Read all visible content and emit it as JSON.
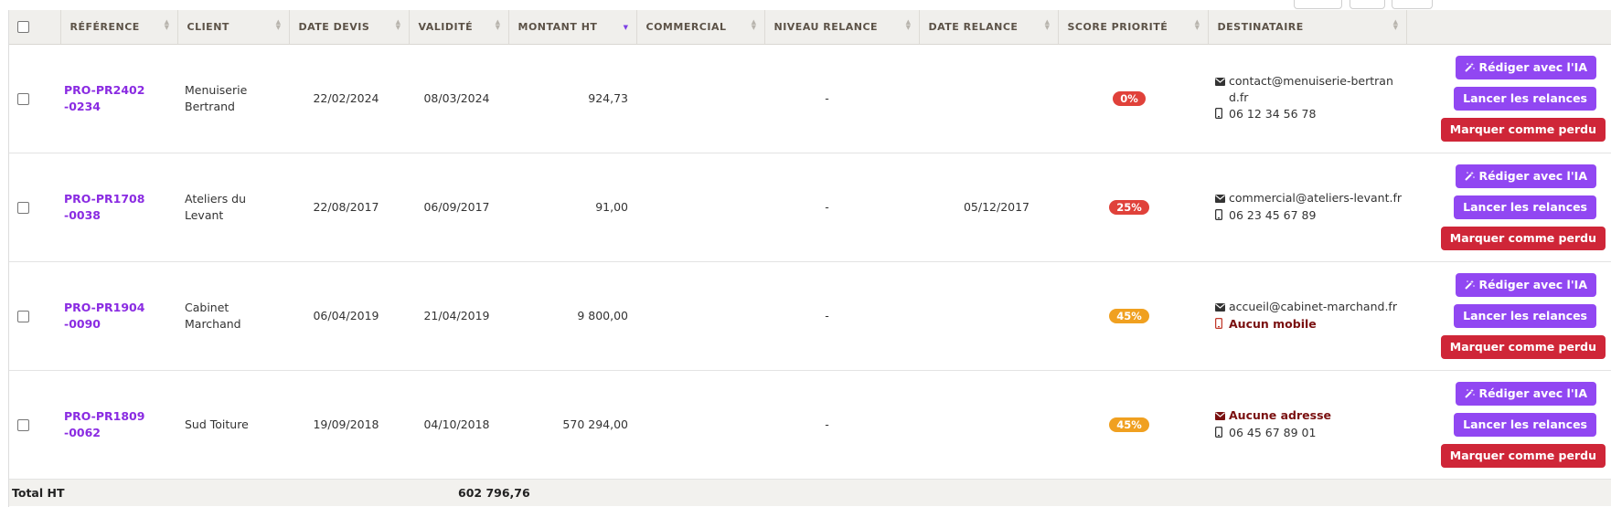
{
  "header": {
    "columns": [
      "RÉFÉRENCE",
      "CLIENT",
      "DATE DEVIS",
      "VALIDITÉ",
      "MONTANT HT",
      "COMMERCIAL",
      "NIVEAU RELANCE",
      "DATE RELANCE",
      "SCORE PRIORITÉ",
      "DESTINATAIRE"
    ],
    "sorted_column": "MONTANT HT",
    "sort_direction": "desc"
  },
  "actions": {
    "ai_label": "Rédiger avec l'IA",
    "relance_label": "Lancer les relances",
    "lost_label": "Marquer comme perdu"
  },
  "rows": [
    {
      "ref": "PRO-PR2402-0234",
      "client": "Menuiserie Bertrand",
      "date_devis": "22/02/2024",
      "validite": "08/03/2024",
      "montant": "924,73",
      "commercial": "",
      "niveau": "-",
      "date_relance": "",
      "score": "0%",
      "score_color": "#e0413a",
      "email": "contact@menuiserie-bertrand.fr",
      "email_missing": false,
      "phone": "06 12 34 56 78",
      "phone_missing": false
    },
    {
      "ref": "PRO-PR1708-0038",
      "client": "Ateliers du Levant",
      "date_devis": "22/08/2017",
      "validite": "06/09/2017",
      "montant": "91,00",
      "commercial": "",
      "niveau": "-",
      "date_relance": "05/12/2017",
      "score": "25%",
      "score_color": "#e0413a",
      "email": "commercial@ateliers-levant.fr",
      "email_missing": false,
      "phone": "06 23 45 67 89",
      "phone_missing": false
    },
    {
      "ref": "PRO-PR1904-0090",
      "client": "Cabinet Marchand",
      "date_devis": "06/04/2019",
      "validite": "21/04/2019",
      "montant": "9 800,00",
      "commercial": "",
      "niveau": "-",
      "date_relance": "",
      "score": "45%",
      "score_color": "#f0a020",
      "email": "accueil@cabinet-marchand.fr",
      "email_missing": false,
      "phone": "Aucun mobile",
      "phone_missing": true
    },
    {
      "ref": "PRO-PR1809-0062",
      "client": "Sud Toiture",
      "date_devis": "19/09/2018",
      "validite": "04/10/2018",
      "montant": "570 294,00",
      "commercial": "",
      "niveau": "-",
      "date_relance": "",
      "score": "45%",
      "score_color": "#f0a020",
      "email": "Aucune adresse",
      "email_missing": true,
      "phone": "06 45 67 89 01",
      "phone_missing": false
    }
  ],
  "footer": {
    "label": "Total HT",
    "total": "602 796,76"
  },
  "colors": {
    "link": "#8a2be2",
    "button_purple": "#9147f2",
    "button_red": "#cf2638",
    "warning_text": "#7a1010"
  },
  "icons": {
    "email": "envelope-icon",
    "phone": "mobile-phone-icon",
    "ai": "magic-wand-icon"
  }
}
